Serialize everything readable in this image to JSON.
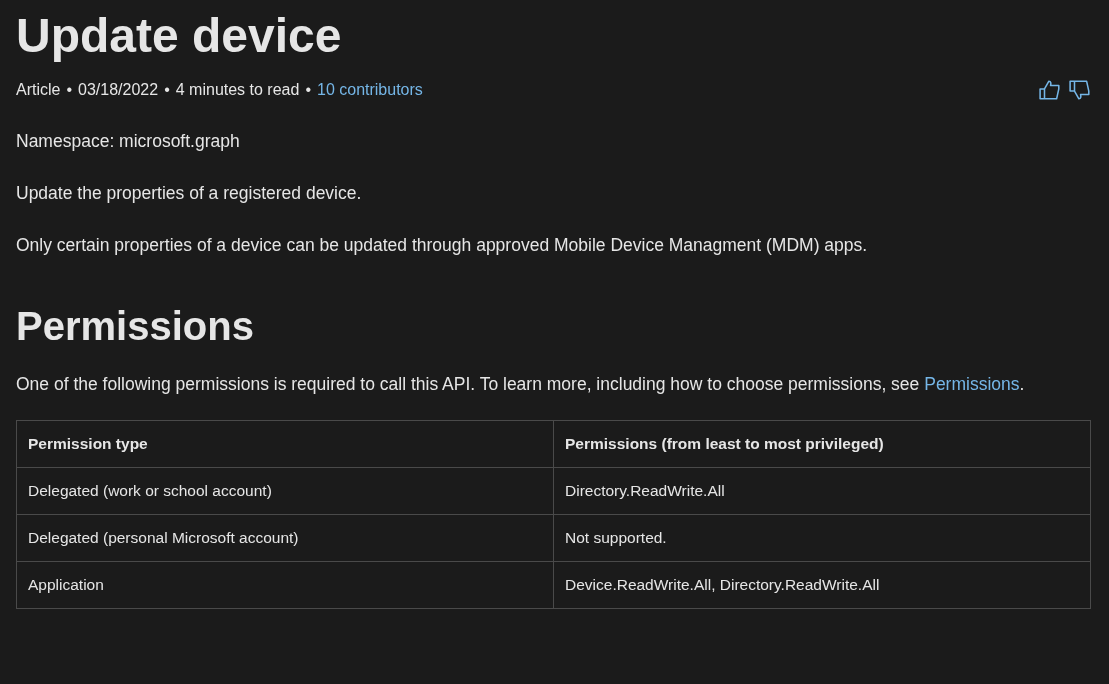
{
  "title": "Update device",
  "meta": [
    {
      "kind": "text",
      "text": "Article"
    },
    {
      "kind": "sep",
      "text": "•"
    },
    {
      "kind": "text",
      "text": "03/18/2022"
    },
    {
      "kind": "sep",
      "text": "•"
    },
    {
      "kind": "text",
      "text": "4 minutes to read"
    },
    {
      "kind": "sep",
      "text": "•"
    },
    {
      "kind": "link",
      "text": "10 contributors"
    }
  ],
  "paragraphs": [
    "Namespace: microsoft.graph",
    "Update the properties of a registered device.",
    "Only certain properties of a device can be updated through approved Mobile Device Managment (MDM) apps."
  ],
  "permissions": {
    "heading": "Permissions",
    "intro": "One of the following permissions is required to call this API. To learn more, including how to choose permissions, see",
    "link": "Permissions",
    "after_link": ".",
    "table": {
      "columns": [
        "Permission type",
        "Permissions (from least to most privileged)"
      ],
      "rows": [
        [
          "Delegated (work or school account)",
          "Directory.ReadWrite.All"
        ],
        [
          "Delegated (personal Microsoft account)",
          "Not supported."
        ],
        [
          "Application",
          "Device.ReadWrite.All, Directory.ReadWrite.All"
        ]
      ]
    }
  }
}
